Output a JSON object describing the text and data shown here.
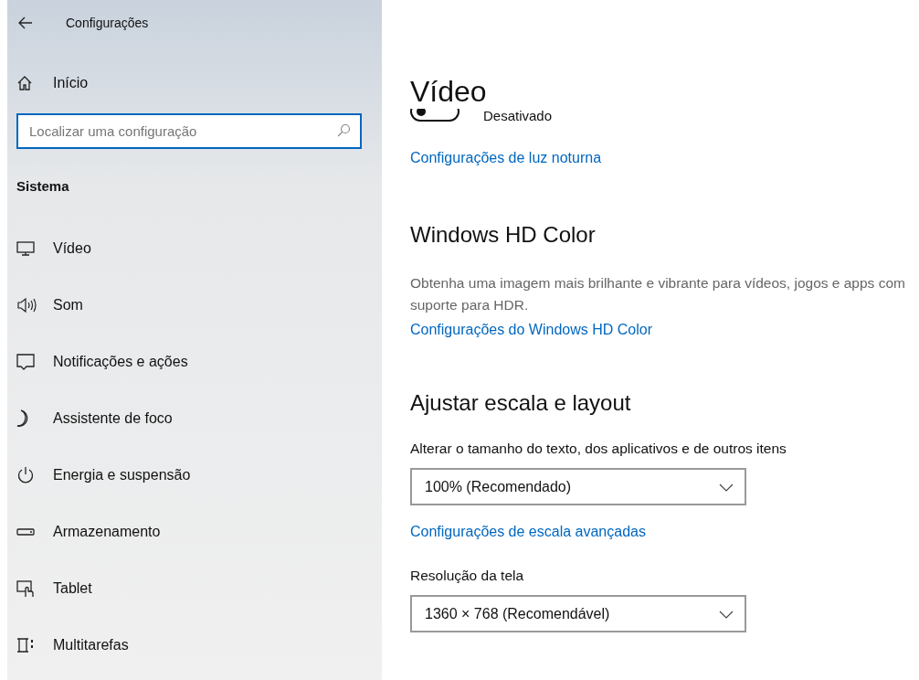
{
  "window": {
    "title": "Configurações"
  },
  "sidebar": {
    "home": "Início",
    "search": {
      "placeholder": "Localizar uma configuração"
    },
    "section": "Sistema",
    "items": [
      {
        "kind": "display",
        "label": "Vídeo"
      },
      {
        "kind": "sound",
        "label": "Som"
      },
      {
        "kind": "notifications",
        "label": "Notificações e ações"
      },
      {
        "kind": "focus",
        "label": "Assistente de foco"
      },
      {
        "kind": "power",
        "label": "Energia e suspensão"
      },
      {
        "kind": "storage",
        "label": "Armazenamento"
      },
      {
        "kind": "tablet",
        "label": "Tablet"
      },
      {
        "kind": "multitask",
        "label": "Multitarefas"
      }
    ]
  },
  "page": {
    "title": "Vídeo",
    "night_light": {
      "on": false,
      "state": "Desativado",
      "link": "Configurações de luz noturna"
    },
    "hd_color": {
      "heading": "Windows HD Color",
      "description": "Obtenha uma imagem mais brilhante e vibrante para vídeos, jogos e apps com suporte para HDR.",
      "link": "Configurações do Windows HD Color"
    },
    "scale": {
      "heading": "Ajustar escala e layout",
      "size_label": "Alterar o tamanho do texto, dos aplicativos e de outros itens",
      "size_value": "100% (Recomendado)",
      "advanced_link": "Configurações de escala avançadas",
      "resolution_label": "Resolução da tela",
      "resolution_value": "1360 × 768 (Recomendável)"
    }
  }
}
